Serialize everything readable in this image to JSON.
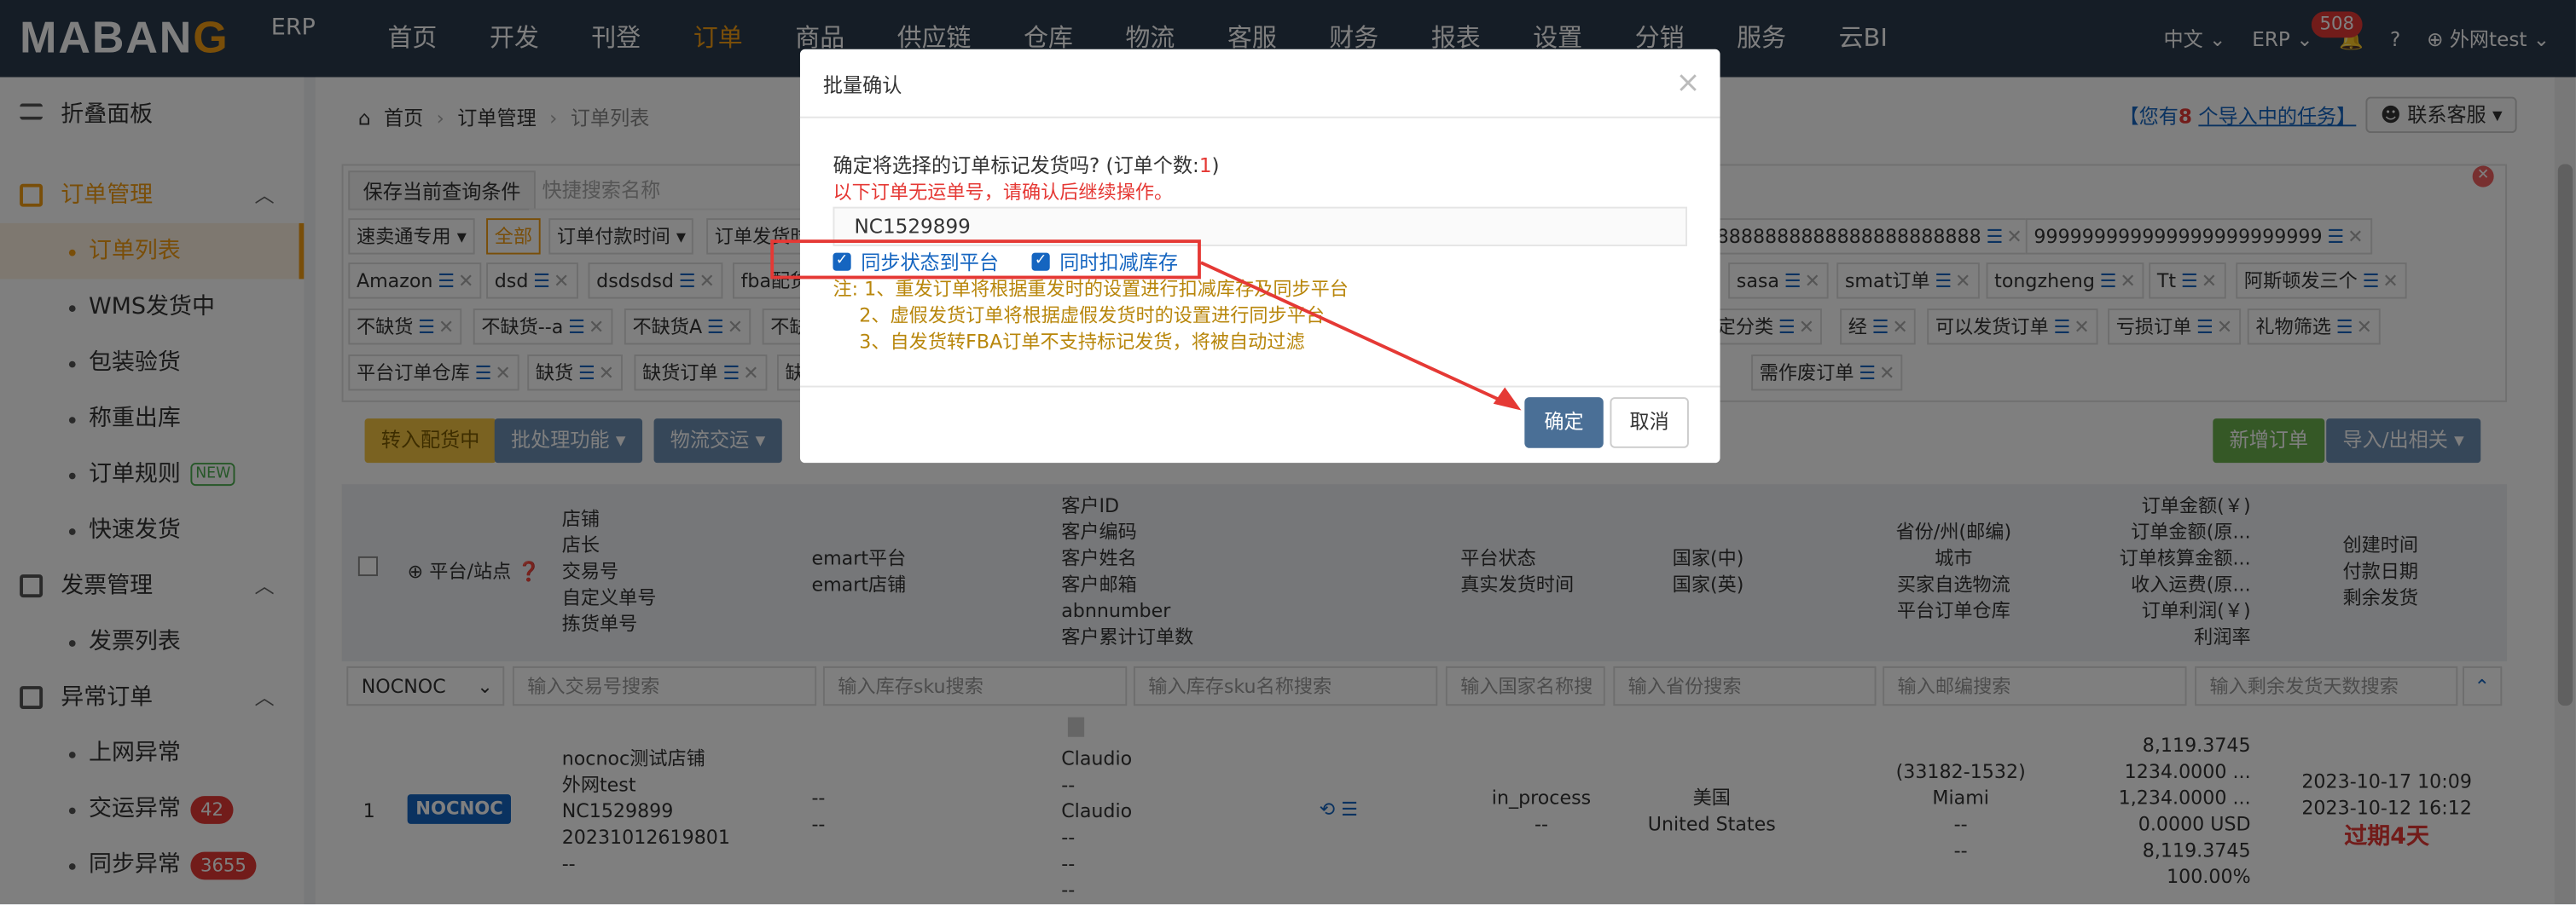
{
  "app": {
    "logo": "MABAN",
    "logo_o": "G",
    "logo_suffix": "ERP"
  },
  "nav": [
    "首页",
    "开发",
    "刊登",
    "订单",
    "商品",
    "供应链",
    "仓库",
    "物流",
    "客服",
    "财务",
    "报表",
    "设置",
    "分销",
    "服务",
    "云BI"
  ],
  "nav_active": "订单",
  "topright": {
    "lang": "中文",
    "erp": "ERP",
    "bell_count": "508",
    "user": "外网test"
  },
  "sidebar": {
    "collapse": "折叠面板",
    "groups": [
      {
        "label": "订单管理",
        "items": [
          "订单列表",
          "WMS发货中",
          "包装验货",
          "称重出库",
          "订单规则",
          "快速发货"
        ]
      },
      {
        "label": "发票管理",
        "items": [
          "发票列表"
        ]
      },
      {
        "label": "异常订单",
        "items": [
          "上网异常",
          "交运异常",
          "同步异常"
        ]
      }
    ],
    "tag_new": "NEW",
    "count_jiaoyun": "42",
    "count_tongbu": "3655"
  },
  "breadcrumb": {
    "home": "首页",
    "level1": "订单管理",
    "current": "订单列表"
  },
  "task": {
    "pre": "【您有",
    "count": "8",
    "post": "个导入中的任务】"
  },
  "contact": "联系客服",
  "query": {
    "save": "保存当前查询条件",
    "search_placeholder": "快捷搜索名称",
    "row1": [
      "速卖通专用",
      "全部",
      "订单付款时间",
      "订单发货时",
      "8888888888888888888888",
      "999999999999999999999999"
    ],
    "row2": [
      "Amazon",
      "dsd",
      "dsdsdsd",
      "fba配货",
      "sasa",
      "smat订单",
      "tongzheng",
      "Tt",
      "阿斯顿发三个"
    ],
    "row3": [
      "不缺货",
      "不缺货--a",
      "不缺货A",
      "不缺",
      "定分类",
      "经",
      "可以发货订单",
      "亏损订单",
      "礼物筛选"
    ],
    "row4": [
      "平台订单仓库",
      "缺货",
      "缺货订单",
      "缺",
      "需作废订单"
    ]
  },
  "actions": {
    "dispatch": "转入配货中",
    "batch": "批处理功能",
    "logistics": "物流交运",
    "new_order": "新增订单",
    "import_export": "导入/出相关"
  },
  "table_head": {
    "platform": "平台/站点",
    "shop": [
      "店铺",
      "店长",
      "交易号",
      "自定义单号",
      "拣货单号"
    ],
    "emart": [
      "emart平台",
      "emart店铺"
    ],
    "customer": [
      "客户ID",
      "客户编码",
      "客户姓名",
      "客户邮箱",
      "abnnumber",
      "客户累计订单数"
    ],
    "pstatus": [
      "平台状态",
      "真实发货时间"
    ],
    "country": [
      "国家(中)",
      "国家(英)"
    ],
    "province": [
      "省份/州(邮编)",
      "城市",
      "买家自选物流",
      "平台订单仓库"
    ],
    "amount": [
      "订单金额(￥)",
      "订单金额(原...",
      "订单核算金额...",
      "收入运费(原...",
      "订单利润(￥)",
      "利润率"
    ],
    "time": [
      "创建时间",
      "付款日期",
      "剩余发货"
    ]
  },
  "filters": {
    "site": "NOCNOC",
    "trade": "输入交易号搜索",
    "sku": "输入库存sku搜索",
    "skuname": "输入库存sku名称搜索",
    "country": "输入国家名称搜",
    "province": "输入省份搜索",
    "zip": "输入邮编搜索",
    "remain": "输入剩余发货天数搜索"
  },
  "row": {
    "index": "1",
    "platform": "NOCNOC",
    "shop": [
      "nocnoc测试店铺",
      "外网test",
      "NC1529899",
      "20231012619801",
      "--"
    ],
    "emart": [
      "--",
      "--"
    ],
    "customer": [
      "Claudio",
      "--",
      "Claudio",
      "--",
      "--",
      "--"
    ],
    "status": "in_process",
    "ship_time": "--",
    "country_cn": "美国",
    "country_en": "United States",
    "province": [
      "(33182-1532)",
      "Miami",
      "--",
      "--"
    ],
    "amounts": [
      "8,119.3745",
      "1234.0000 ...",
      "1,234.0000 ...",
      "0.0000 USD",
      "8,119.3745",
      "100.00%"
    ],
    "times": [
      "2023-10-17 10:09",
      "2023-10-12 16:12"
    ],
    "overdue": "过期4天"
  },
  "modal": {
    "title": "批量确认",
    "question_pre": "确定将选择的订单标记发货吗? (订单个数:",
    "question_count": "1",
    "question_post": ")",
    "warning": "以下订单无运单号，请确认后继续操作。",
    "order_no": "NC1529899",
    "cb1": "同步状态到平台",
    "cb2": "同时扣减库存",
    "notes": [
      "注: 1、重发订单将根据重发时的设置进行扣减库存及同步平台",
      "2、虚假发货订单将根据虚假发货时的设置进行同步平台",
      "3、自发货转FBA订单不支持标记发货，将被自动过滤"
    ],
    "ok": "确定",
    "cancel": "取消"
  },
  "colors": {
    "topbar": "#2b3a4c",
    "accent": "#f39c12",
    "primary": "#4a6f96",
    "danger": "#e53935"
  }
}
